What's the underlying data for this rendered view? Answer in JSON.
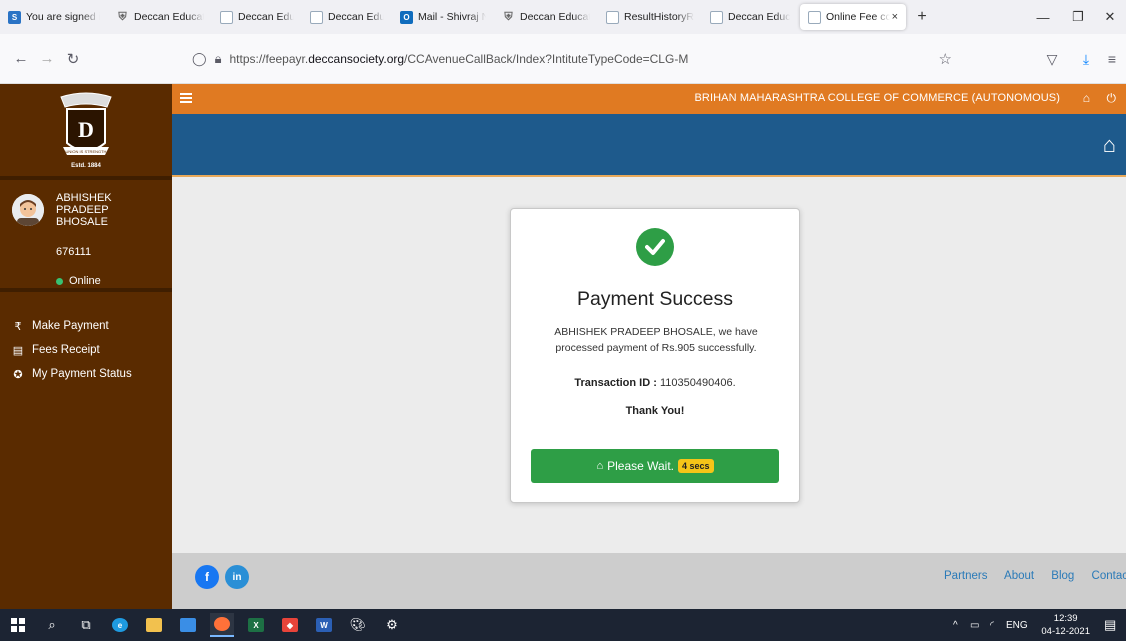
{
  "browser": {
    "tabs": [
      {
        "label": "You are signed in",
        "icon": "s-app-icon",
        "color": "#2a73c5"
      },
      {
        "label": "Deccan Education",
        "icon": "deccan-icon"
      },
      {
        "label": "Deccan Education",
        "icon": "page-icon"
      },
      {
        "label": "Deccan Education",
        "icon": "page-icon"
      },
      {
        "label": "Mail - Shivraj N",
        "icon": "outlook-icon",
        "color": "#0f6cbd"
      },
      {
        "label": "Deccan Education",
        "icon": "deccan-icon"
      },
      {
        "label": "ResultHistoryRe",
        "icon": "page-icon"
      },
      {
        "label": "Deccan Education",
        "icon": "page-icon"
      },
      {
        "label": "Online Fee cc",
        "icon": "page-icon",
        "active": true
      }
    ],
    "new_tab": "+",
    "close_tab": "×",
    "url_prefix": "https://feepayr.",
    "url_host": "deccansociety.org",
    "url_path": "/CCAvenueCallBack/Index?IntituteTypeCode=CLG-M"
  },
  "app": {
    "college_name": "BRIHAN MAHARASHTRA COLLEGE OF COMMERCE (AUTONOMOUS)",
    "logo_estd": "Estd. 1884",
    "logo_motto": "UNION IS STRENGTH",
    "theme": {
      "sidebar": "#5a2b00",
      "header": "#e07a22",
      "banner": "#1e5a8c",
      "success": "#2e9e46"
    }
  },
  "user": {
    "name_line1": "ABHISHEK",
    "name_line2": "PRADEEP",
    "name_line3": "BHOSALE",
    "id": "676111",
    "status": "Online"
  },
  "menu": [
    {
      "label": "Make Payment",
      "icon": "rupee-icon",
      "glyph": "₹"
    },
    {
      "label": "Fees Receipt",
      "icon": "receipt-icon",
      "glyph": "▤"
    },
    {
      "label": "My Payment Status",
      "icon": "status-icon",
      "glyph": "✪"
    }
  ],
  "payment": {
    "title": "Payment Success",
    "message": "ABHISHEK PRADEEP BHOSALE, we have processed payment of Rs.905 successfully.",
    "transaction_label": "Transaction ID :",
    "transaction_id": "110350490406.",
    "thanks": "Thank You!",
    "wait_label": "Please Wait.",
    "wait_seconds": "4 secs"
  },
  "footer": {
    "links": [
      "Partners",
      "About",
      "Blog",
      "Contac"
    ]
  },
  "taskbar": {
    "language": "ENG",
    "time": "12:39",
    "date": "04-12-2021"
  }
}
